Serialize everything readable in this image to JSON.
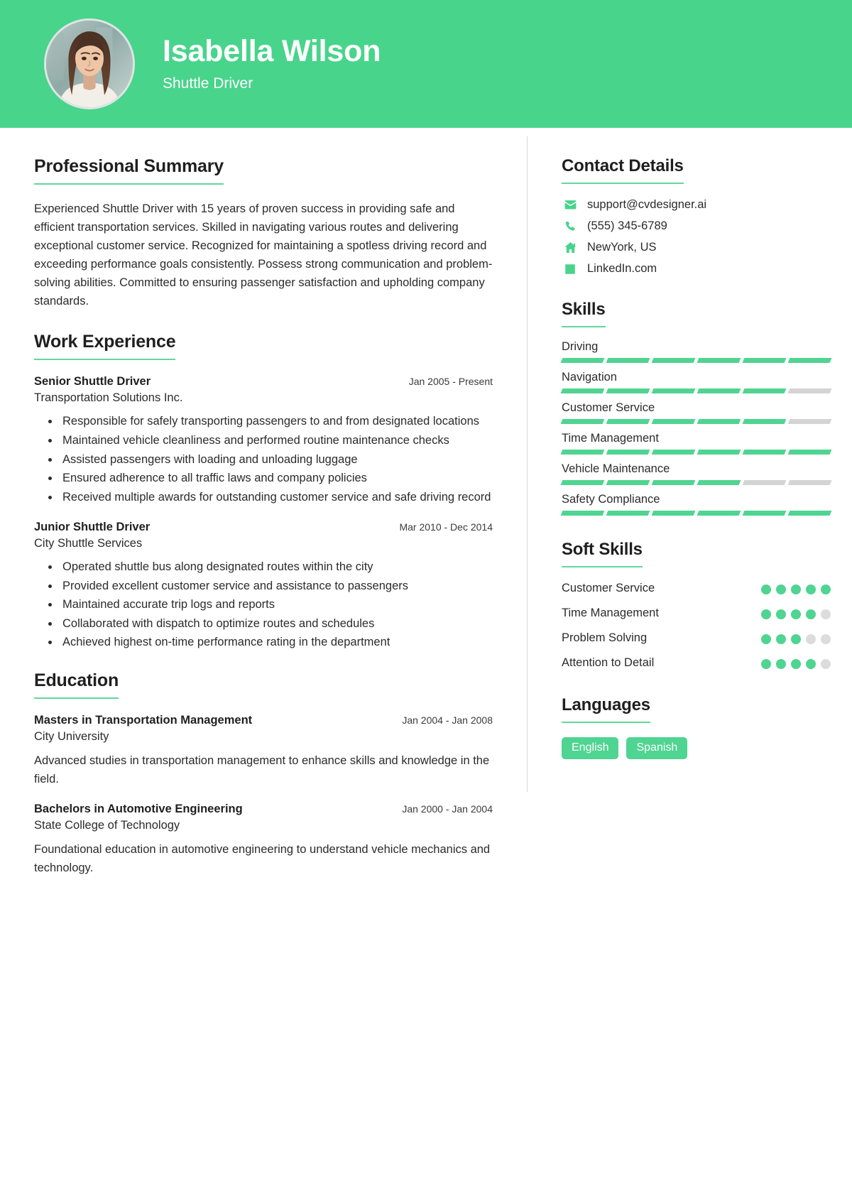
{
  "theme": {
    "accent": "#48d48b",
    "accent_bar": "#4fd491",
    "accent_underline": "#63d79b",
    "bar_empty": "#d4d4d4",
    "dot_empty": "#dcdcdc",
    "text": "#2b2b2b"
  },
  "header": {
    "name": "Isabella Wilson",
    "title": "Shuttle Driver",
    "avatar_icon": "portrait-photo"
  },
  "main": {
    "summary": {
      "heading": "Professional Summary",
      "text": "Experienced Shuttle Driver with 15 years of proven success in providing safe and efficient transportation services. Skilled in navigating various routes and delivering exceptional customer service. Recognized for maintaining a spotless driving record and exceeding performance goals consistently. Possess strong communication and problem-solving abilities. Committed to ensuring passenger satisfaction and upholding company standards."
    },
    "work": {
      "heading": "Work Experience",
      "entries": [
        {
          "role": "Senior Shuttle Driver",
          "date": "Jan 2005 - Present",
          "org": "Transportation Solutions Inc.",
          "bullets": [
            "Responsible for safely transporting passengers to and from designated locations",
            "Maintained vehicle cleanliness and performed routine maintenance checks",
            "Assisted passengers with loading and unloading luggage",
            "Ensured adherence to all traffic laws and company policies",
            "Received multiple awards for outstanding customer service and safe driving record"
          ]
        },
        {
          "role": "Junior Shuttle Driver",
          "date": "Mar 2010 - Dec 2014",
          "org": "City Shuttle Services",
          "bullets": [
            "Operated shuttle bus along designated routes within the city",
            "Provided excellent customer service and assistance to passengers",
            "Maintained accurate trip logs and reports",
            "Collaborated with dispatch to optimize routes and schedules",
            "Achieved highest on-time performance rating in the department"
          ]
        }
      ]
    },
    "education": {
      "heading": "Education",
      "entries": [
        {
          "degree": "Masters in Transportation Management",
          "date": "Jan 2004 - Jan 2008",
          "school": "City University",
          "desc": "Advanced studies in transportation management to enhance skills and knowledge in the field."
        },
        {
          "degree": "Bachelors in Automotive Engineering",
          "date": "Jan 2000 - Jan 2004",
          "school": "State College of Technology",
          "desc": "Foundational education in automotive engineering to understand vehicle mechanics and technology."
        }
      ]
    }
  },
  "sidebar": {
    "contact": {
      "heading": "Contact Details",
      "items": [
        {
          "icon": "envelope-icon",
          "value": "support@cvdesigner.ai"
        },
        {
          "icon": "phone-icon",
          "value": "(555) 345-6789"
        },
        {
          "icon": "home-icon",
          "value": "NewYork, US"
        },
        {
          "icon": "linkedin-icon",
          "value": "LinkedIn.com"
        }
      ]
    },
    "skills": {
      "heading": "Skills",
      "segments": 6,
      "items": [
        {
          "label": "Driving",
          "filled": 6
        },
        {
          "label": "Navigation",
          "filled": 5
        },
        {
          "label": "Customer Service",
          "filled": 5
        },
        {
          "label": "Time Management",
          "filled": 6
        },
        {
          "label": "Vehicle Maintenance",
          "filled": 4
        },
        {
          "label": "Safety Compliance",
          "filled": 6
        }
      ]
    },
    "soft_skills": {
      "heading": "Soft Skills",
      "dots": 5,
      "items": [
        {
          "label": "Customer Service",
          "filled": 5
        },
        {
          "label": "Time Management",
          "filled": 4
        },
        {
          "label": "Problem Solving",
          "filled": 3
        },
        {
          "label": "Attention to Detail",
          "filled": 4
        }
      ]
    },
    "languages": {
      "heading": "Languages",
      "items": [
        "English",
        "Spanish"
      ]
    }
  }
}
